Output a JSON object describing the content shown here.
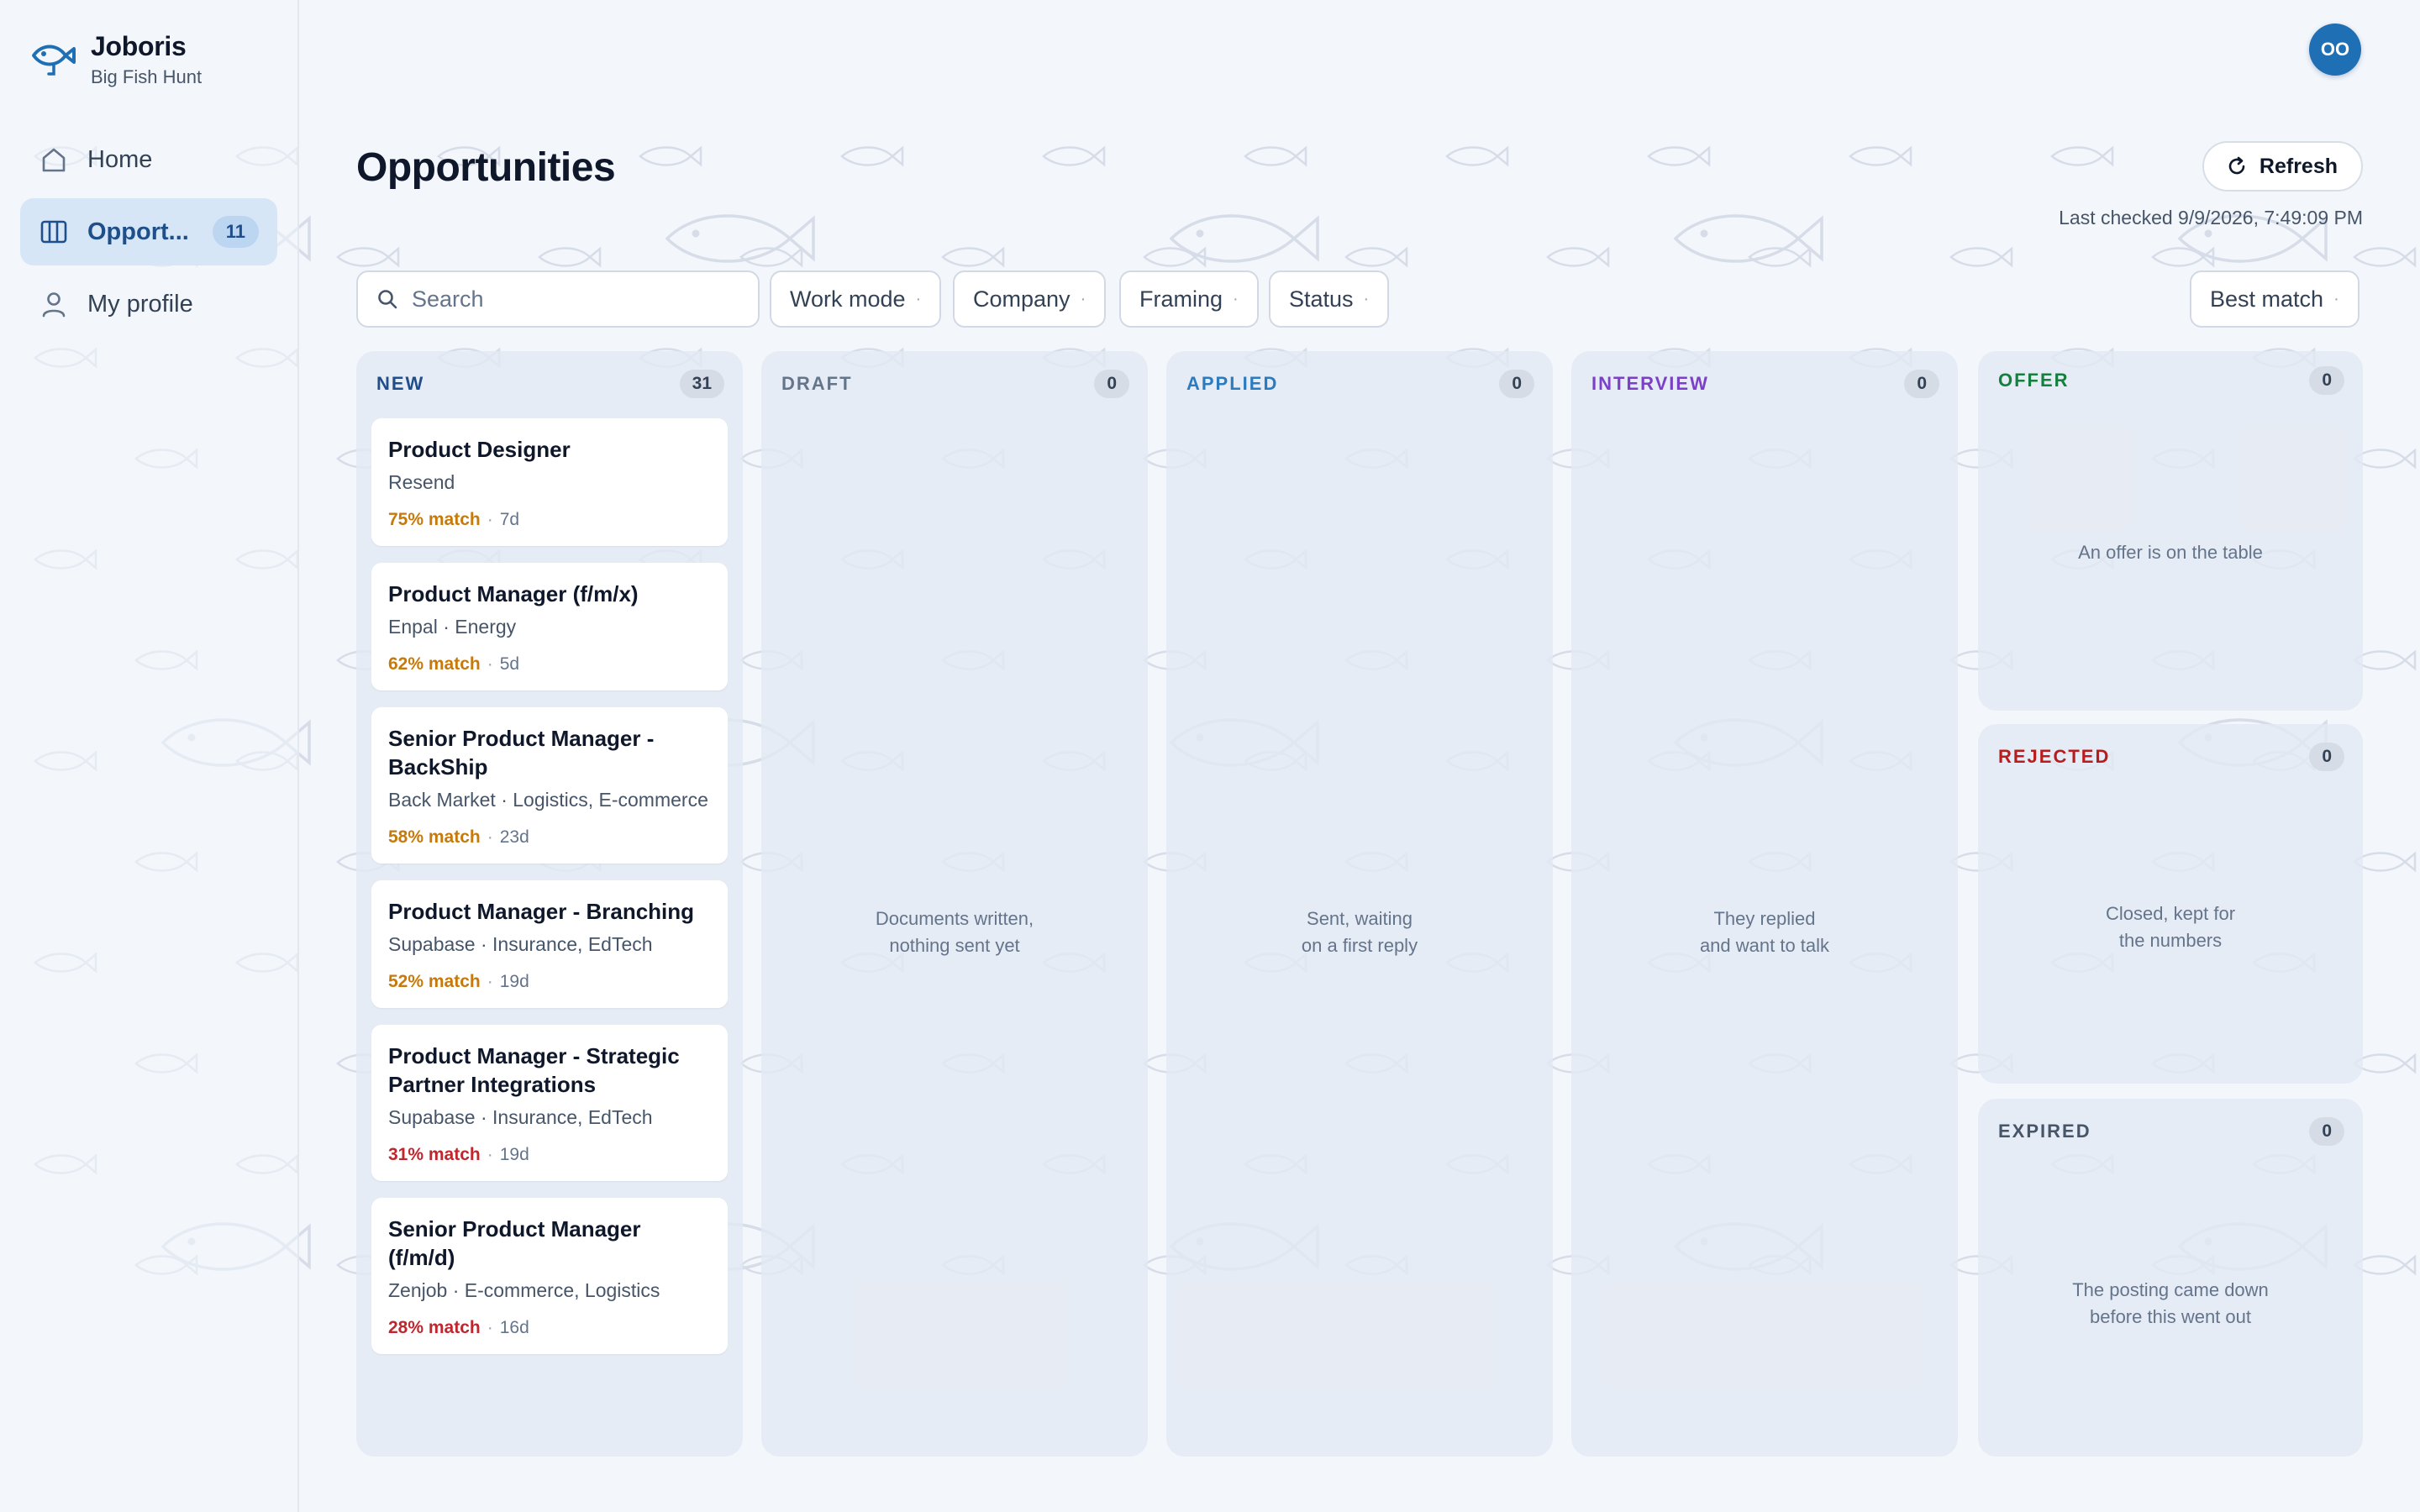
{
  "app": {
    "name": "Joboris",
    "tagline": "Big Fish Hunt",
    "avatar_initials": "OO"
  },
  "sidebar": {
    "items": [
      {
        "label": "Home",
        "icon": "home-icon",
        "active": false
      },
      {
        "label": "Opport...",
        "icon": "board-icon",
        "active": true,
        "count": "11"
      },
      {
        "label": "My profile",
        "icon": "user-icon",
        "active": false
      }
    ]
  },
  "page": {
    "title": "Opportunities",
    "refresh_label": "Refresh",
    "last_checked": "Last checked 9/9/2026, 7:49:09 PM"
  },
  "filters": {
    "search_placeholder": "Search",
    "work_mode": "Work mode",
    "company": "Company",
    "framing": "Framing",
    "status": "Status",
    "sort": "Best match"
  },
  "columns": {
    "new": {
      "title": "NEW",
      "count": "31",
      "color": "#1e4f8a"
    },
    "draft": {
      "title": "DRAFT",
      "count": "0",
      "color": "#64748b",
      "empty_line1": "Documents written,",
      "empty_line2": "nothing sent yet"
    },
    "applied": {
      "title": "APPLIED",
      "count": "0",
      "color": "#2b7bc0",
      "empty_line1": "Sent, waiting",
      "empty_line2": "on a first reply"
    },
    "interview": {
      "title": "INTERVIEW",
      "count": "0",
      "color": "#7b3fc8",
      "empty_line1": "They replied",
      "empty_line2": "and want to talk"
    },
    "offer": {
      "title": "OFFER",
      "count": "0",
      "color": "#15803d",
      "empty_line1": "An offer is on the table"
    },
    "rejected": {
      "title": "REJECTED",
      "count": "0",
      "color": "#b91c1c",
      "empty_line1": "Closed, kept for",
      "empty_line2": "the numbers"
    },
    "expired": {
      "title": "EXPIRED",
      "count": "0",
      "color": "#475569",
      "empty_line1": "The posting came down",
      "empty_line2": "before this went out"
    }
  },
  "cards": [
    {
      "title": "Product Designer",
      "meta": "Resend",
      "match": "75% match",
      "age": "7d",
      "match_color": "#c77a0a"
    },
    {
      "title": "Product Manager (f/m/x)",
      "meta": "Enpal · Energy",
      "match": "62% match",
      "age": "5d",
      "match_color": "#c77a0a"
    },
    {
      "title": "Senior Product Manager - BackShip",
      "meta": "Back Market · Logistics, E-commerce",
      "match": "58% match",
      "age": "23d",
      "match_color": "#c77a0a"
    },
    {
      "title": "Product Manager - Branching",
      "meta": "Supabase · Insurance, EdTech",
      "match": "52% match",
      "age": "19d",
      "match_color": "#c77a0a"
    },
    {
      "title": "Product Manager - Strategic Partner Integrations",
      "meta": "Supabase · Insurance, EdTech",
      "match": "31% match",
      "age": "19d",
      "match_color": "#c0262d"
    },
    {
      "title": "Senior Product Manager (f/m/d)",
      "meta": "Zenjob · E-commerce, Logistics",
      "match": "28% match",
      "age": "16d",
      "match_color": "#c0262d"
    }
  ]
}
